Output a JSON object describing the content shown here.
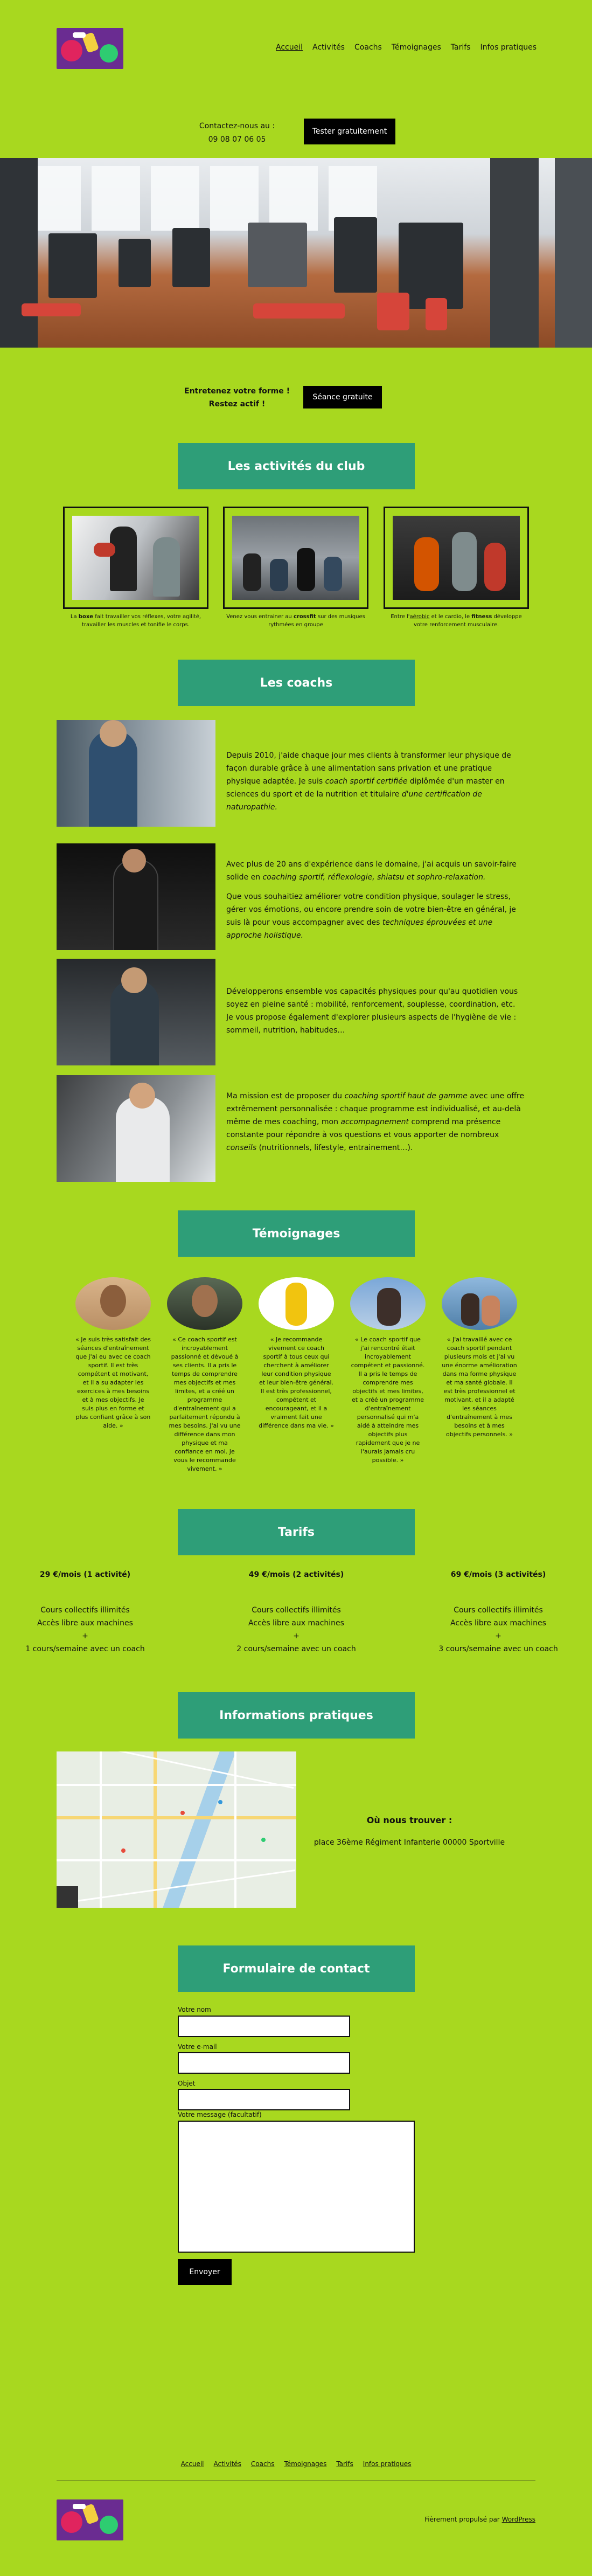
{
  "nav": [
    {
      "label": "Accueil",
      "active": true
    },
    {
      "label": "Activités"
    },
    {
      "label": "Coachs"
    },
    {
      "label": "Témoignages"
    },
    {
      "label": "Tarifs"
    },
    {
      "label": "Infos pratiques"
    }
  ],
  "contact": {
    "line1": "Contactez-nous au :",
    "line2": "09 08 07 06 05",
    "button": "Tester gratuitement"
  },
  "cta": {
    "line1": "Entretenez votre forme !",
    "line2": "Restez actif !",
    "button": "Séance gratuite"
  },
  "activities": {
    "title": "Les activités du club",
    "items": [
      {
        "pre": "La ",
        "bold": "boxe",
        "post": " fait travailler vos réflexes, votre agilité, travailler les muscles et tonifie le corps."
      },
      {
        "pre": "Venez vous entrainer au ",
        "bold": "crossfit",
        "post": " sur des musiques rythmées en groupe"
      },
      {
        "pre": "Entre l'",
        "link": "aérobic",
        "mid": " et le cardio, le ",
        "bold": "fitness",
        "post": " développe votre renforcement musculaire."
      }
    ]
  },
  "coaches": {
    "title": "Les coachs",
    "c1": {
      "a": "Depuis 2010, j'aide chaque jour mes clients à transformer leur physique de façon durable grâce à une alimentation sans privation et une pratique physique adaptée.",
      "b": "Je suis ",
      "b_em": "coach sportif certifiée",
      "c": " diplômée d'un master en sciences du sport et de la nutrition et titulaire ",
      "c_em": "d'une certification de naturopathie."
    },
    "c2": {
      "p1a": "Avec plus de 20 ans d'expérience dans le domaine, j'ai acquis un savoir-faire solide en ",
      "p1em": "coaching sportif, réflexologie, shiatsu et sophro-relaxation.",
      "p2a": "Que vous souhaitiez améliorer votre condition physique, soulager le stress, gérer vos émotions, ou encore prendre soin de votre bien-être en général, je suis là pour vous accompagner avec des ",
      "p2em": "techniques éprouvées et une approche holistique."
    },
    "c3": {
      "p1": "Développerons ensemble vos capacités physiques pour qu'au quotidien vous soyez en pleine santé : mobilité, renforcement, souplesse, coordination, etc.",
      "p2": "Je vous propose également d'explorer plusieurs aspects de l'hygiène de vie : sommeil, nutrition, habitudes…"
    },
    "c4": {
      "a": "Ma mission est de proposer du ",
      "a_em": "coaching sportif haut de gamme",
      "b": " avec une offre extrêmement personnalisée : chaque programme est individualisé, et au-delà même de mes coaching, mon ",
      "b_em": "accompagnement",
      "c": " comprend ma présence constante pour répondre à vos questions et vous apporter de nombreux ",
      "c_em": "conseils",
      "d": " (nutritionnels, lifestyle, entrainement…)."
    }
  },
  "testimonials": {
    "title": "Témoignages",
    "items": [
      "« Je suis très satisfait des séances d'entraînement que j'ai eu avec ce coach sportif. Il est très compétent et motivant, et il a su adapter les exercices à mes besoins et à mes objectifs. Je suis plus en forme et plus confiant grâce à son aide. »",
      "« Ce coach sportif est incroyablement passionné et dévoué à ses clients. Il a pris le temps de comprendre mes objectifs et mes limites, et a créé un programme d'entraînement qui a parfaitement répondu à mes besoins. J'ai vu une différence dans mon physique et ma confiance en moi. Je vous le recommande vivement. »",
      "« Je recommande vivement ce coach sportif à tous ceux qui cherchent à améliorer leur condition physique et leur bien-être général. Il est très professionnel, compétent et encourageant, et il a vraiment fait une différence dans ma vie. »",
      "« Le coach sportif que j'ai rencontré était incroyablement compétent et passionné. Il a pris le temps de comprendre mes objectifs et mes limites, et a créé un programme d'entraînement personnalisé qui m'a aidé à atteindre mes objectifs plus rapidement que je ne l'aurais jamais cru possible. »",
      "« J'ai travaillé avec ce coach sportif pendant plusieurs mois et j'ai vu une énorme amélioration dans ma forme physique et ma santé globale. Il est très professionnel et motivant, et il a adapté les séances d'entraînement à mes besoins et à mes objectifs personnels. »"
    ]
  },
  "pricing": {
    "title": "Tarifs",
    "plans": [
      {
        "name": "29 €/mois (1 activité)",
        "l1": "Cours collectifs illimités",
        "l2": "Accès libre aux machines",
        "plus": "+",
        "l3": "1 cours/semaine avec un coach"
      },
      {
        "name": "49 €/mois (2 activités)",
        "l1": "Cours collectifs illimités",
        "l2": "Accès libre aux machines",
        "plus": "+",
        "l3": "2 cours/semaine avec un coach"
      },
      {
        "name": "69 €/mois (3 activités)",
        "l1": "Cours collectifs illimités",
        "l2": "Accès libre aux machines",
        "plus": "+",
        "l3": "3 cours/semaine avec un coach"
      }
    ]
  },
  "info": {
    "title": "Informations pratiques",
    "where_title": "Où nous trouver :",
    "address": "place 36ème Régiment Infanterie 00000 Sportville"
  },
  "form": {
    "title": "Formulaire de contact",
    "name": "Votre nom",
    "email": "Votre e-mail",
    "subject": "Objet",
    "message": "Votre message (facultatif)",
    "button": "Envoyer"
  },
  "footer": {
    "powered_pre": "Fièrement propulsé par ",
    "powered_link": "WordPress"
  },
  "colors": {
    "background": "#a8d81f",
    "accent": "#2e9e78",
    "button": "#000000"
  }
}
